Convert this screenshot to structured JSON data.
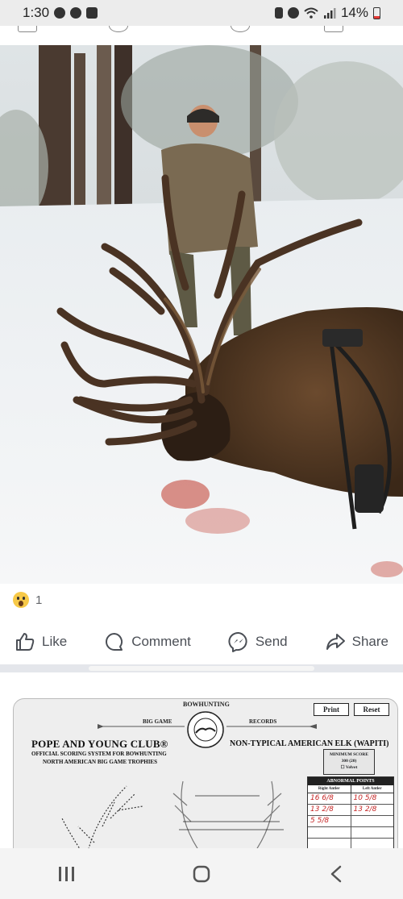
{
  "status_bar": {
    "time": "1:30",
    "battery": "14%",
    "left_icons": [
      "alert-icon",
      "messenger-icon",
      "gallery-icon"
    ],
    "right_icons": [
      "sim-icon",
      "alarm-icon",
      "wifi-icon",
      "signal-icon",
      "battery-icon"
    ]
  },
  "post": {
    "photo_alt": "Hunter kneeling behind a large harvested non-typical bull elk in snowy forest with compound bow",
    "reactions": {
      "icon": "wow-icon",
      "count": "1"
    },
    "actions": [
      {
        "label": "Like",
        "icon": "thumbs-up-icon"
      },
      {
        "label": "Comment",
        "icon": "comment-icon"
      },
      {
        "label": "Send",
        "icon": "messenger-icon"
      },
      {
        "label": "Share",
        "icon": "share-icon"
      }
    ]
  },
  "scorecard": {
    "bowhunting": "BOWHUNTING",
    "big_game": "BIG GAME",
    "records": "RECORDS",
    "print_label": "Print",
    "reset_label": "Reset",
    "club_title": "POPE AND YOUNG CLUB®",
    "subtitle_1": "OFFICIAL SCORING SYSTEM FOR BOWHUNTING",
    "subtitle_2": "NORTH AMERICAN BIG GAME TROPHIES",
    "species": "NON-TYPICAL AMERICAN ELK (WAPITI)",
    "min_score_label": "MINIMUM SCORE",
    "min_score_value": "300 (20)",
    "velvet_label": "Velvet",
    "abnormal_title": "ABNORMAL POINTS",
    "right_antler": "Right Antler",
    "left_antler": "Left Antler",
    "abnormal_rows": [
      {
        "right": "16 6/8",
        "left": "10 5/8"
      },
      {
        "right": "13 2/8",
        "left": "13 2/8"
      },
      {
        "right": "5 5/8",
        "left": ""
      },
      {
        "right": "",
        "left": ""
      },
      {
        "right": "",
        "left": ""
      },
      {
        "right": "",
        "left": ""
      }
    ]
  },
  "nav_bar": {
    "buttons": [
      "recent-apps-icon",
      "home-icon",
      "back-icon"
    ]
  }
}
